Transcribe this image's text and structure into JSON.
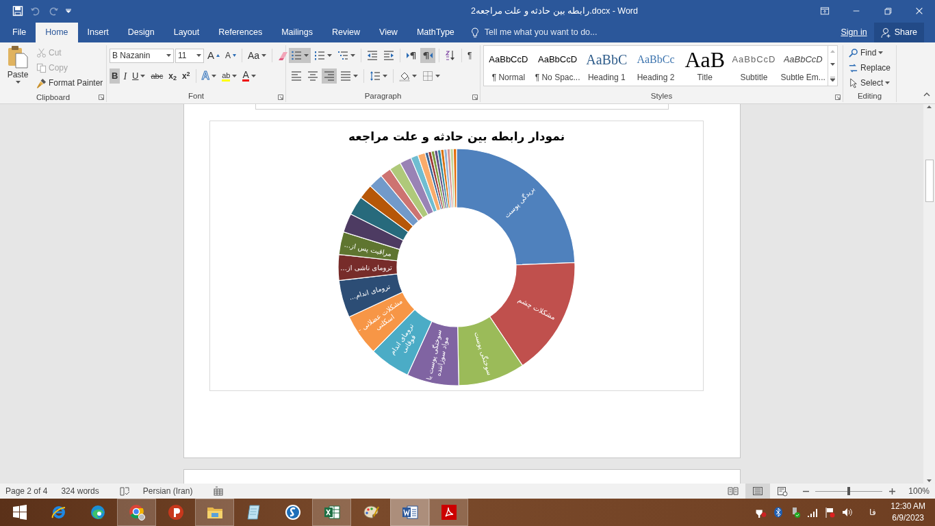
{
  "window": {
    "title": "رابطه بین حادثه و علت مراجعه2.docx - Word"
  },
  "quick_access": [
    {
      "kind": "save",
      "disabled": false
    },
    {
      "kind": "undo",
      "disabled": true
    },
    {
      "kind": "redo",
      "disabled": true
    },
    {
      "kind": "customize",
      "disabled": false
    }
  ],
  "tabs": [
    {
      "label": "File",
      "selected": false
    },
    {
      "label": "Home",
      "selected": true
    },
    {
      "label": "Insert",
      "selected": false
    },
    {
      "label": "Design",
      "selected": false
    },
    {
      "label": "Layout",
      "selected": false
    },
    {
      "label": "References",
      "selected": false
    },
    {
      "label": "Mailings",
      "selected": false
    },
    {
      "label": "Review",
      "selected": false
    },
    {
      "label": "View",
      "selected": false
    },
    {
      "label": "MathType",
      "selected": false
    }
  ],
  "tell_me": {
    "placeholder": "Tell me what you want to do..."
  },
  "account": {
    "sign_in": "Sign in",
    "share": "Share"
  },
  "ribbon": {
    "clipboard": {
      "label": "Clipboard",
      "paste": "Paste",
      "items": [
        {
          "kind": "cut",
          "label": "Cut",
          "disabled": true
        },
        {
          "kind": "copy",
          "label": "Copy",
          "disabled": true
        },
        {
          "kind": "painter",
          "label": "Format Painter",
          "disabled": false
        }
      ]
    },
    "font": {
      "label": "Font",
      "name": "B Nazanin",
      "size": "11",
      "row1": [
        {
          "kind": "grow",
          "text": "A"
        },
        {
          "kind": "shrink",
          "text": "A"
        },
        {
          "kind": "case",
          "text": "Aa"
        },
        {
          "kind": "clear"
        }
      ],
      "row2": [
        {
          "kind": "bold",
          "text": "B",
          "selected": true
        },
        {
          "kind": "italic",
          "text": "I",
          "selected": false
        },
        {
          "kind": "underline",
          "text": "U",
          "selected": false
        },
        {
          "kind": "strike",
          "text": "abc",
          "selected": false
        },
        {
          "kind": "sub",
          "text": "x$_{2}$",
          "selected": false
        },
        {
          "kind": "sup",
          "text": "x$^{2}$",
          "selected": false
        },
        {
          "kind": "effects",
          "text": "A",
          "selected": false
        },
        {
          "kind": "highlight",
          "text": "ab",
          "selected": false
        },
        {
          "kind": "color",
          "text": "A",
          "selected": false
        }
      ]
    },
    "paragraph": {
      "label": "Paragraph",
      "row1": [
        {
          "kind": "bullets",
          "selected": true
        },
        {
          "kind": "numbering",
          "selected": false
        },
        {
          "kind": "multilevel",
          "selected": false
        },
        {
          "kind": "outdent",
          "selected": false
        },
        {
          "kind": "indent",
          "selected": false
        },
        {
          "kind": "ltr",
          "selected": false
        },
        {
          "kind": "rtl",
          "selected": true
        },
        {
          "kind": "sort",
          "selected": false
        },
        {
          "kind": "marks",
          "text": "¶",
          "selected": false
        }
      ],
      "row2": [
        {
          "kind": "align_left",
          "selected": false
        },
        {
          "kind": "center",
          "selected": false
        },
        {
          "kind": "align_right",
          "selected": true
        },
        {
          "kind": "justify",
          "selected": false
        },
        {
          "kind": "line_spacing",
          "selected": false
        },
        {
          "kind": "shading",
          "selected": false
        },
        {
          "kind": "borders",
          "selected": false
        }
      ]
    },
    "styles": {
      "label": "Styles",
      "items": [
        {
          "kind": "normal",
          "preview": "AaBbCcD",
          "name": "¶ Normal"
        },
        {
          "kind": "no_spacing",
          "preview": "AaBbCcD",
          "name": "¶ No Spac..."
        },
        {
          "kind": "heading1",
          "preview": "AaBbC",
          "name": "Heading 1"
        },
        {
          "kind": "heading2",
          "preview": "AaBbCc",
          "name": "Heading 2"
        },
        {
          "kind": "title",
          "preview": "AaB",
          "name": "Title"
        },
        {
          "kind": "subtitle",
          "preview": "AaBbCcD",
          "name": "Subtitle"
        },
        {
          "kind": "subtle",
          "preview": "AaBbCcD",
          "name": "Subtle Em..."
        }
      ]
    },
    "editing": {
      "label": "Editing",
      "items": [
        {
          "kind": "find",
          "label": "Find"
        },
        {
          "kind": "replace",
          "label": "Replace"
        },
        {
          "kind": "select",
          "label": "Select"
        }
      ]
    }
  },
  "document": {
    "chart": {
      "chart_data": {
        "type": "donut",
        "title": "نمودار رابطه بین حادثه و علت مراجعه",
        "categories": [
          "بریدگی پوست",
          "مشکلات چشم",
          "سوختگی پوست",
          "سوختگی پوست با مواد سوزاننده",
          "ترومای اندام فوقانی",
          "مشکلات عضلانی - اسکلتی",
          "ترومای اندام...",
          "ترومای ناشی از...",
          "مراقبت پس از...",
          null,
          null,
          null,
          null,
          null,
          null,
          null,
          null,
          null,
          null,
          null,
          null,
          null,
          null,
          null,
          null,
          null,
          null,
          null
        ],
        "values": [
          24.4,
          16.2,
          9.1,
          7.1,
          5.6,
          5.7,
          5.1,
          3.5,
          3.1,
          2.6,
          2.6,
          2.0,
          2.0,
          1.5,
          1.6,
          1.6,
          1.0,
          1.0,
          0.43,
          0.43,
          0.43,
          0.43,
          0.43,
          0.43,
          0.43,
          0.43,
          0.43,
          0.43
        ],
        "colors": [
          "#4f81bd",
          "#c0504d",
          "#9bbb59",
          "#8064a2",
          "#4bacc6",
          "#f79646",
          "#2c4d75",
          "#772c2a",
          "#5f7530",
          "#4d3b62",
          "#276a7c",
          "#b65708",
          "#729aca",
          "#cd7371",
          "#afc97a",
          "#9983b5",
          "#6fbdd1",
          "#f9ab6b",
          "#3a6595",
          "#9c3a38",
          "#7c9a3f",
          "#644e80",
          "#35899f",
          "#d87212",
          "#95b3d7",
          "#d99694",
          "#c3d69b",
          "#e46c0a"
        ]
      }
    }
  },
  "status_bar": {
    "page": "Page 2 of 4",
    "words": "324 words",
    "language": "Persian (Iran)",
    "views": [
      {
        "kind": "read",
        "selected": false
      },
      {
        "kind": "print",
        "selected": true
      },
      {
        "kind": "web",
        "selected": false
      }
    ],
    "zoom": {
      "level": 0.5,
      "reading": "100%"
    }
  },
  "taskbar": {
    "apps": [
      {
        "kind": "start",
        "open": false,
        "active": false
      },
      {
        "kind": "ie",
        "open": false,
        "active": false
      },
      {
        "kind": "edge",
        "open": false,
        "active": false
      },
      {
        "kind": "chrome",
        "open": true,
        "active": false
      },
      {
        "kind": "psiphon",
        "open": false,
        "active": false
      },
      {
        "kind": "explorer",
        "open": true,
        "active": false
      },
      {
        "kind": "notepad",
        "open": false,
        "active": false
      },
      {
        "kind": "skype",
        "open": false,
        "active": false
      },
      {
        "kind": "excel",
        "open": true,
        "active": false
      },
      {
        "kind": "paint",
        "open": false,
        "active": false
      },
      {
        "kind": "word",
        "open": true,
        "active": true
      },
      {
        "kind": "acrobat",
        "open": true,
        "active": false
      }
    ],
    "tray": {
      "language": "فا",
      "time": "12:30 AM",
      "date": "6/9/2023"
    }
  }
}
